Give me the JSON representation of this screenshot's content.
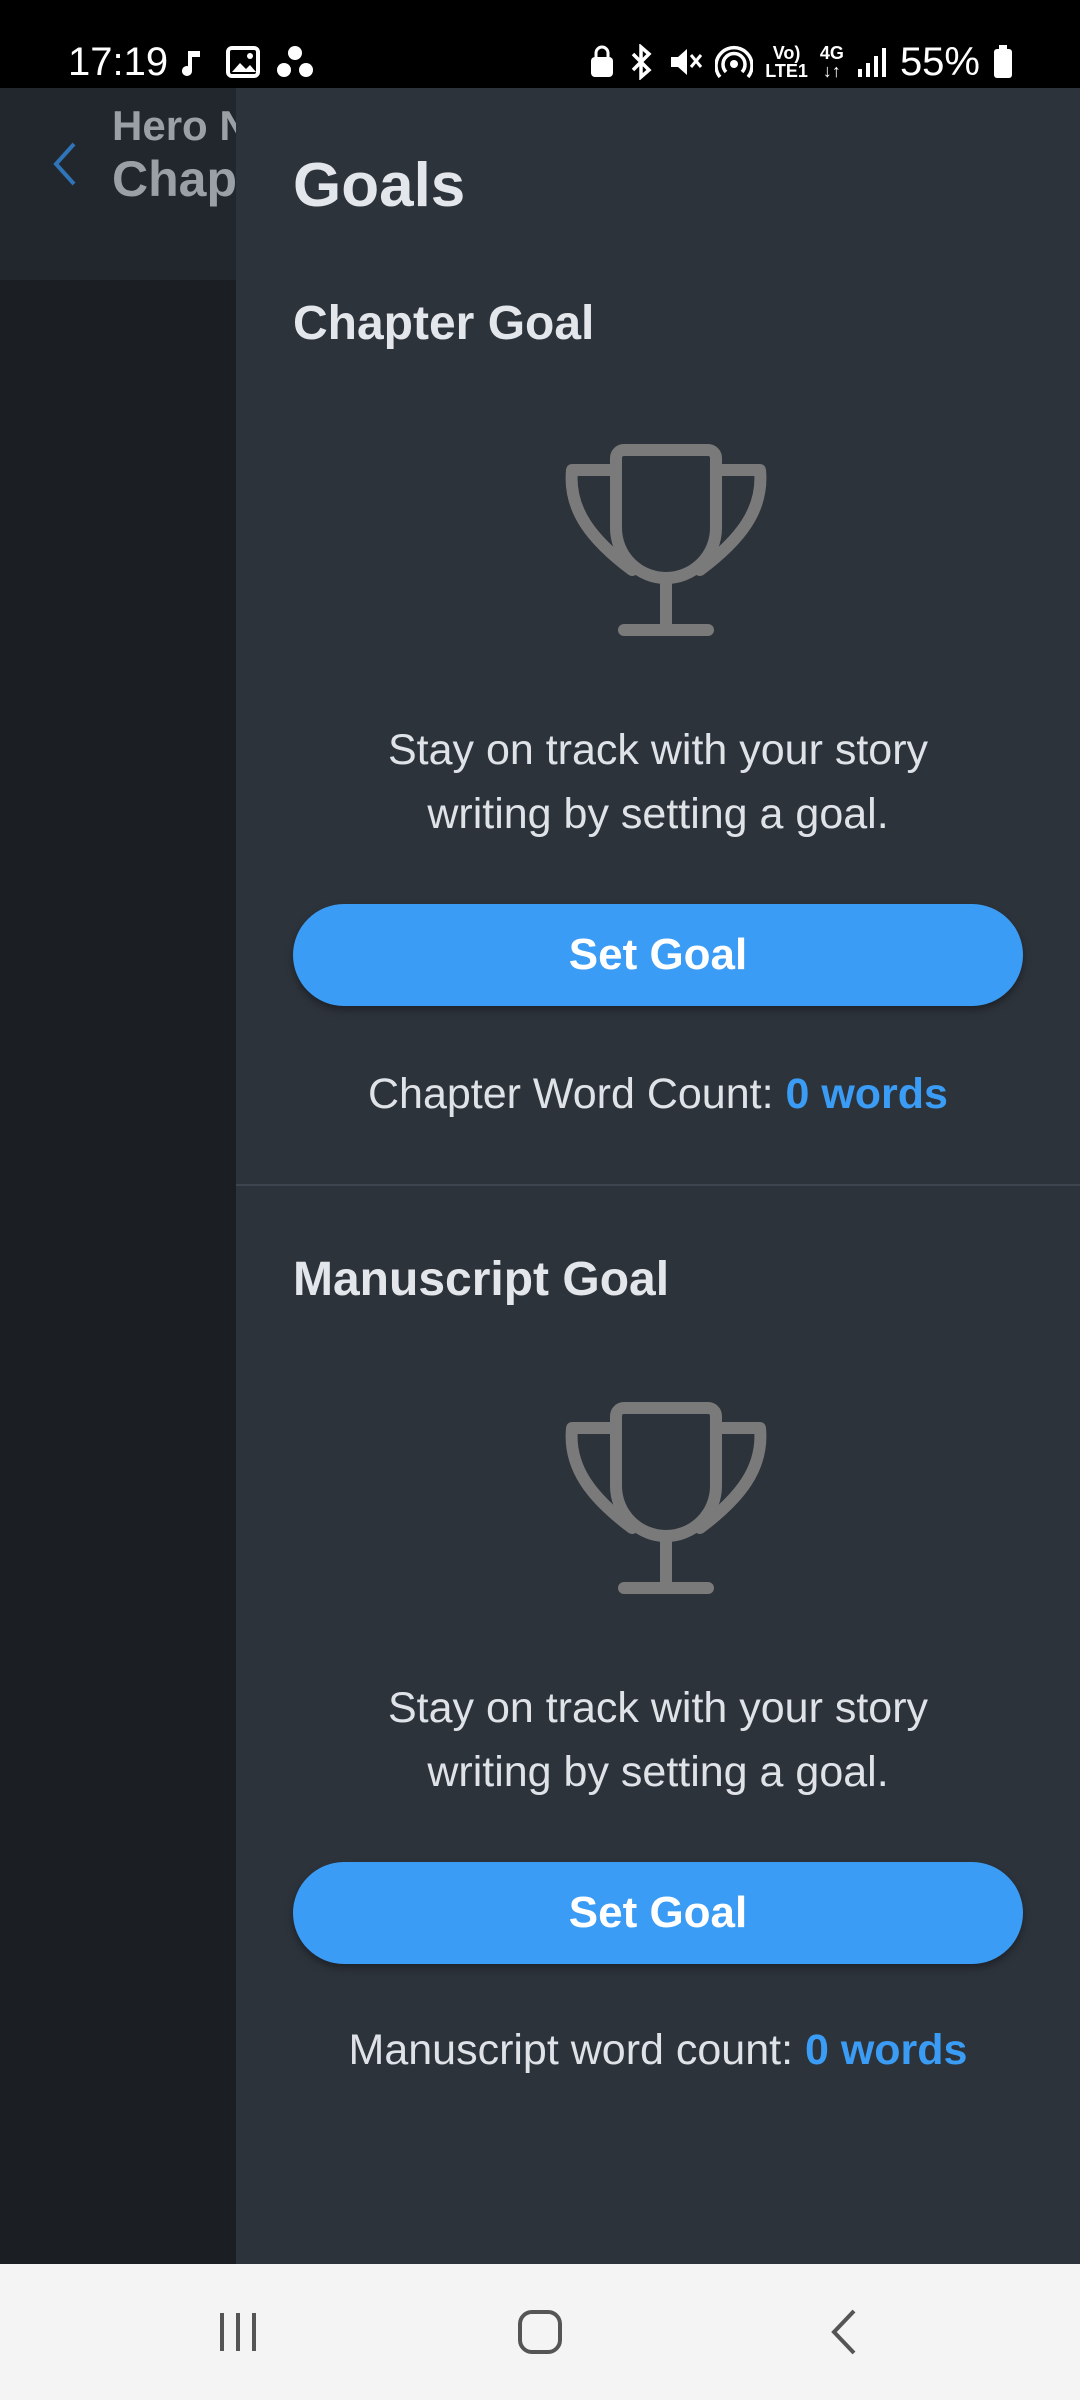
{
  "status_bar": {
    "time": "17:19",
    "battery_percent": "55%",
    "network_label_top": "Vo)",
    "network_label_bottom": "LTE1",
    "network_type": "4G",
    "left_icons": [
      "music-icon",
      "image-icon",
      "dots-icon"
    ],
    "right_icons": [
      "lock-icon",
      "bluetooth-icon",
      "mute-icon",
      "hotspot-icon",
      "signal-icon",
      "battery-icon"
    ]
  },
  "background_app": {
    "title_line1": "Hero N",
    "title_line2": "Chap"
  },
  "drawer": {
    "title": "Goals",
    "chapter": {
      "heading": "Chapter Goal",
      "description_line1": "Stay on track with your story",
      "description_line2": "writing by setting a goal.",
      "button_label": "Set Goal",
      "count_label": "Chapter Word Count:",
      "count_value": "0 words"
    },
    "manuscript": {
      "heading": "Manuscript Goal",
      "description_line1": "Stay on track with your story",
      "description_line2": "writing by setting a goal.",
      "button_label": "Set Goal",
      "count_label": "Manuscript word count:",
      "count_value": "0 words"
    }
  },
  "nav_bar": {
    "buttons": [
      "recents-icon",
      "home-icon",
      "back-icon"
    ]
  },
  "colors": {
    "accent": "#3b9cf5",
    "drawer_bg": "#2d333b",
    "trophy": "#7a7a7a"
  }
}
